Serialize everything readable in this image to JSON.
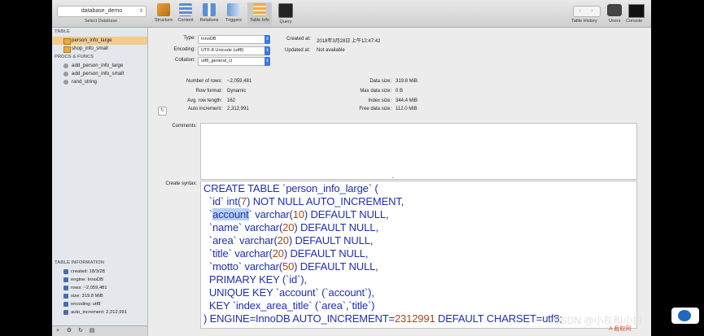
{
  "toolbar": {
    "database": "database_demo",
    "select_caption": "Select Database",
    "buttons": [
      "Structure",
      "Content",
      "Relations",
      "Triggers",
      "Table Info",
      "Query"
    ],
    "right_labels": [
      "Table History",
      "Users",
      "Console"
    ],
    "active": "Table Info"
  },
  "sidebar": {
    "tables_header": "TABLE",
    "tables": [
      "person_info_large",
      "shop_info_small"
    ],
    "procs_header": "PROCS & FUNCS",
    "procs": [
      "add_person_info_large",
      "add_person_info_small",
      "rand_string"
    ],
    "info_header": "TABLE INFORMATION",
    "info": [
      "created: 18/3/28",
      "engine: InnoDB",
      "rows: ~2,059,481",
      "size: 319.8 MiB",
      "encoding: utf8",
      "auto_increment: 2,312,991"
    ]
  },
  "meta": {
    "type_label": "Type:",
    "type_value": "InnoDB",
    "encoding_label": "Encoding:",
    "encoding_value": "UTF-8 Unicode (utf8)",
    "collation_label": "Collation:",
    "collation_value": "utf8_general_ci",
    "created_label": "Created at:",
    "created_value": "2018年3月28日 上午12:47:42",
    "updated_label": "Updated at:",
    "updated_value": "Not available"
  },
  "stats": {
    "rows_label": "Number of rows:",
    "rows_value": "~2,059,481",
    "format_label": "Row format:",
    "format_value": "Dynamic",
    "avglen_label": "Avg. row length:",
    "avglen_value": "162",
    "autoinc_label": "Auto increment:",
    "autoinc_value": "2,312,991",
    "datasize_label": "Data size:",
    "datasize_value": "319.8 MiB",
    "maxdata_label": "Max data size:",
    "maxdata_value": "0 B",
    "index_label": "Index size:",
    "index_value": "344.4 MiB",
    "free_label": "Free data size:",
    "free_value": "112.0 MiB"
  },
  "comments_label": "Comments:",
  "syntax_label": "Create syntax:",
  "syntax": {
    "l1": "CREATE TABLE `person_info_large` (",
    "l2_a": "  `id` int(",
    "l2_n": "7",
    "l2_b": ") NOT NULL AUTO_INCREMENT,",
    "l3_a": "  `",
    "l3_hl": "account",
    "l3_b": "` varchar(",
    "l3_n": "10",
    "l3_c": ") DEFAULT NULL,",
    "l4_a": "  `name` varchar(",
    "l4_n": "20",
    "l4_b": ") DEFAULT NULL,",
    "l5_a": "  `area` varchar(",
    "l5_n": "20",
    "l5_b": ") DEFAULT NULL,",
    "l6_a": "  `title` varchar(",
    "l6_n": "20",
    "l6_b": ") DEFAULT NULL,",
    "l7_a": "  `motto` varchar(",
    "l7_n": "50",
    "l7_b": ") DEFAULT NULL,",
    "l8": "  PRIMARY KEY (`id`),",
    "l9": "  UNIQUE KEY `account` (`account`),",
    "l10": "  KEY `index_area_title` (`area`,`title`)",
    "l11_a": ") ENGINE=InnoDB AUTO_INCREMENT=",
    "l11_n": "2312991",
    "l11_b": " DEFAULT CHARSET=utf8;"
  },
  "watermark": "CSDN @小灰和小白",
  "watermark_sub": "A 截取网"
}
